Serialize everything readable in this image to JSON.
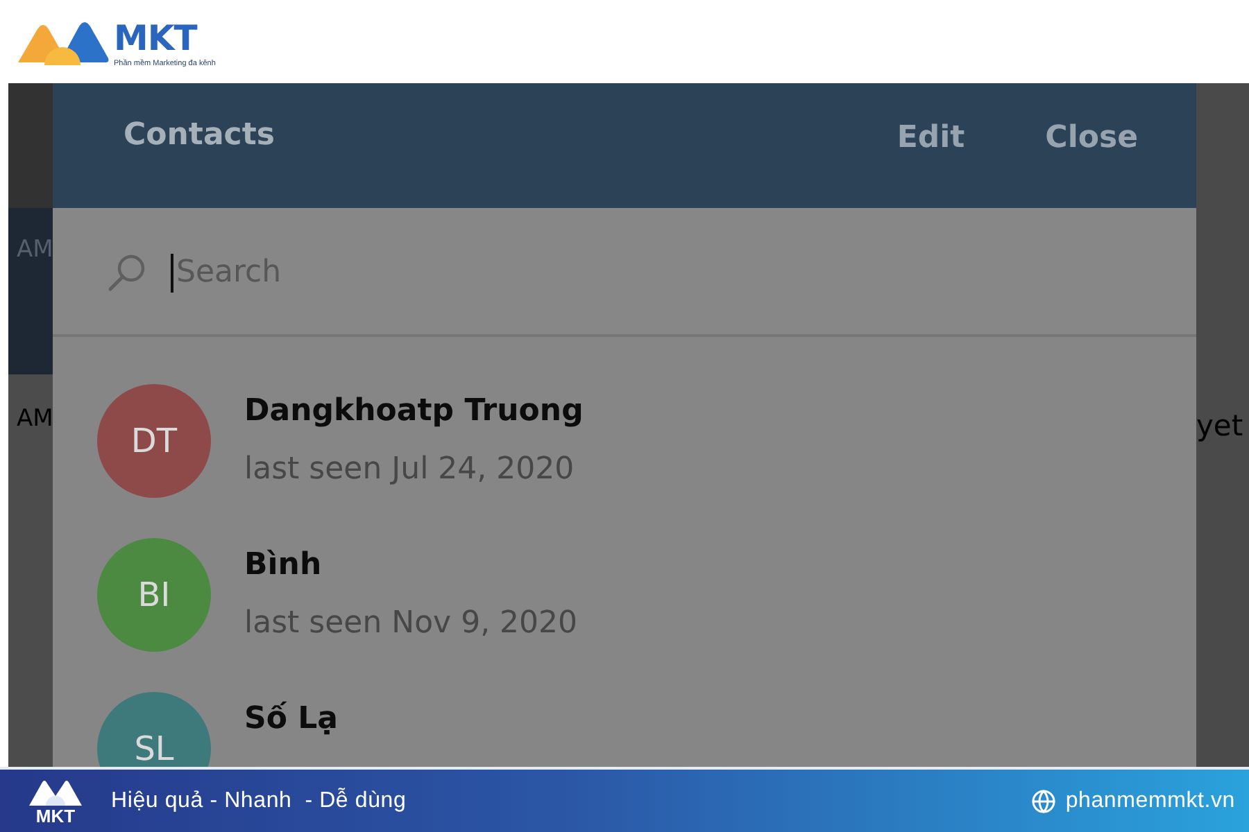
{
  "brand": {
    "name": "MKT",
    "tagline": "Phần mềm Marketing đa kênh"
  },
  "backdrop": {
    "left_texts": [
      "AM",
      "AM"
    ],
    "right_text": "yet"
  },
  "dialog": {
    "title": "Contacts",
    "actions": [
      "Edit",
      "Close"
    ],
    "search": {
      "placeholder": "Search",
      "focused": true
    },
    "contacts": [
      {
        "initials": "DT",
        "name": "Dangkhoatp Truong",
        "status": "last seen Jul 24, 2020",
        "color": "#8e4949"
      },
      {
        "initials": "BI",
        "name": "Bình",
        "status": "last seen Nov 9, 2020",
        "color": "#4d8a41"
      },
      {
        "initials": "SL",
        "name": "Số Lạ",
        "color": "#3e7a7b"
      }
    ]
  },
  "footer": {
    "logo_text": "MKT",
    "slogan": "Hiệu quả - Nhanh  - Dễ dùng",
    "website": "phanmemmkt.vn"
  }
}
